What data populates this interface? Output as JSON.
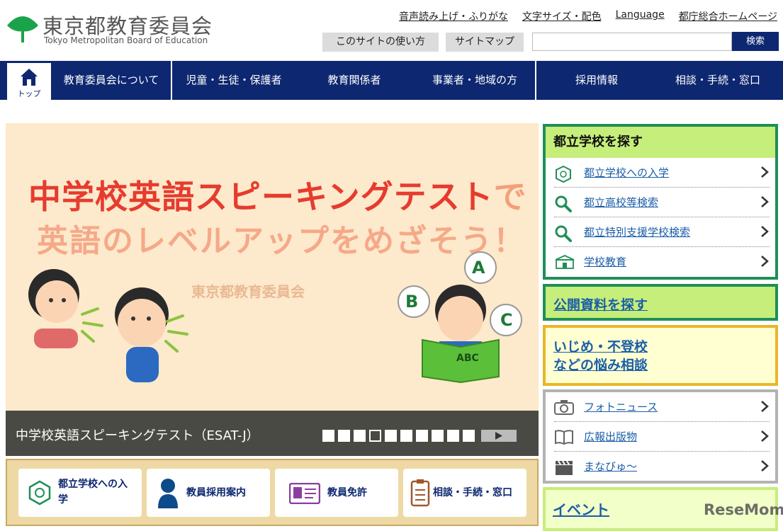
{
  "header": {
    "org_name": "東京都教育委員会",
    "org_name_en": "Tokyo Metropolitan Board of Education",
    "top_links": [
      "音声読み上げ・ふりがな",
      "文字サイズ・配色",
      "Language",
      "都庁総合ホームページ"
    ],
    "howto_label": "このサイトの使い方",
    "sitemap_label": "サイトマップ",
    "search_placeholder": "",
    "search_button": "検索"
  },
  "nav": {
    "home_label": "トップ",
    "items": [
      "教育委員会について",
      "児童・生徒・保護者",
      "教育関係者",
      "事業者・地域の方",
      "採用情報",
      "相談・手続・窓口"
    ]
  },
  "hero": {
    "headline_main": "中学校英語スピーキングテスト",
    "headline_suffix": "で",
    "headline_sub": "英語のレベルアップをめざそう！",
    "org_text": "東京都教育委員会",
    "bubble_letters": [
      "A",
      "B",
      "C"
    ],
    "book_text": "ABC",
    "caption": "中学校英語スピーキングテスト（ESAT-J）",
    "slide_count": 10,
    "active_slide": 4
  },
  "quick_links": [
    {
      "label": "都立学校への入学",
      "icon": "school-emblem-icon"
    },
    {
      "label": "教員採用案内",
      "icon": "teacher-icon"
    },
    {
      "label": "教員免許",
      "icon": "license-card-icon"
    },
    {
      "label": "相談・手続・窓口",
      "icon": "clipboard-icon"
    }
  ],
  "sidebar": {
    "find_school": {
      "title": "都立学校を探す",
      "items": [
        {
          "label": "都立学校への入学",
          "icon": "school-emblem-icon"
        },
        {
          "label": "都立高校等検索",
          "icon": "search-icon"
        },
        {
          "label": "都立特別支援学校検索",
          "icon": "search-icon"
        },
        {
          "label": "学校教育",
          "icon": "school-building-icon"
        }
      ]
    },
    "public_docs": "公開資料を探す",
    "bullying_line1": "いじめ・不登校",
    "bullying_line2": "などの悩み相談",
    "media": [
      {
        "label": "フォトニュース",
        "icon": "camera-icon"
      },
      {
        "label": "広報出版物",
        "icon": "book-icon"
      },
      {
        "label": "まなびゅ～",
        "icon": "clapperboard-icon"
      }
    ],
    "events": "イベント"
  },
  "watermark": "ReseMom",
  "colors": {
    "navy": "#0d2770",
    "green_border": "#1f8f57",
    "lime": "#c6ee7a",
    "link_blue": "#1b5ea8",
    "hero_bg": "#fde9cb",
    "headline_red": "#e63b2e"
  }
}
